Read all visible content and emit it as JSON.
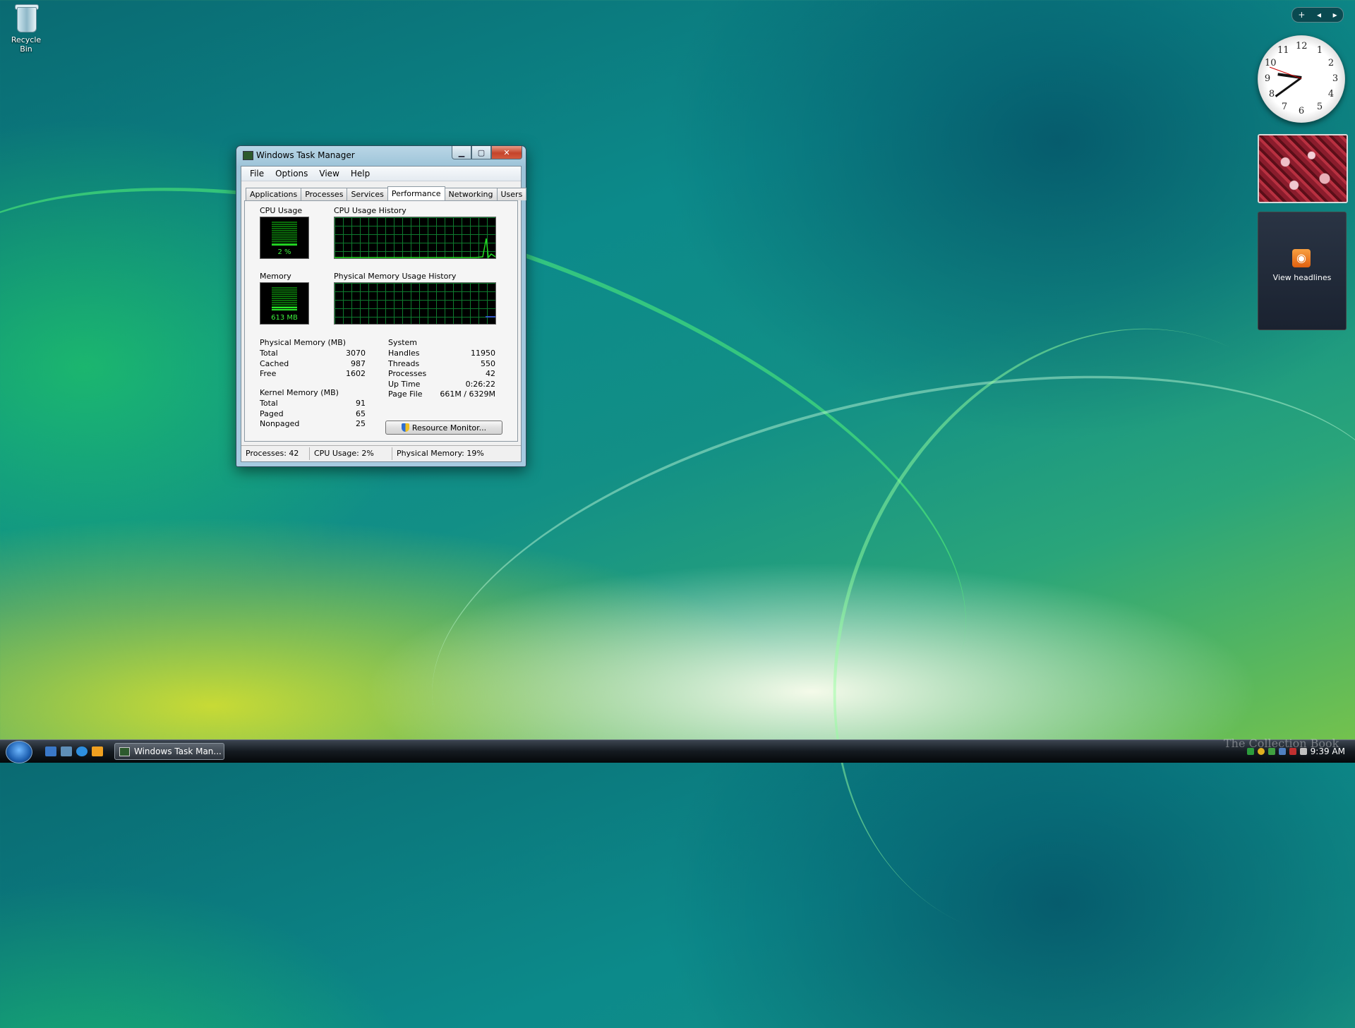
{
  "desktop": {
    "recycle_bin_label": "Recycle Bin"
  },
  "window": {
    "title": "Windows Task Manager",
    "menu": [
      "File",
      "Options",
      "View",
      "Help"
    ],
    "tabs": [
      "Applications",
      "Processes",
      "Services",
      "Performance",
      "Networking",
      "Users"
    ],
    "active_tab": "Performance",
    "cpu_usage": {
      "title": "CPU Usage",
      "value_label": "2 %",
      "percent": 2
    },
    "cpu_history": {
      "title": "CPU Usage History"
    },
    "memory": {
      "title": "Memory",
      "value_label": "613 MB",
      "percent": 19
    },
    "memory_history": {
      "title": "Physical Memory Usage History"
    },
    "physical_memory": {
      "title": "Physical Memory (MB)",
      "rows": [
        {
          "label": "Total",
          "value": "3070"
        },
        {
          "label": "Cached",
          "value": "987"
        },
        {
          "label": "Free",
          "value": "1602"
        }
      ]
    },
    "kernel_memory": {
      "title": "Kernel Memory (MB)",
      "rows": [
        {
          "label": "Total",
          "value": "91"
        },
        {
          "label": "Paged",
          "value": "65"
        },
        {
          "label": "Nonpaged",
          "value": "25"
        }
      ]
    },
    "system": {
      "title": "System",
      "rows": [
        {
          "label": "Handles",
          "value": "11950"
        },
        {
          "label": "Threads",
          "value": "550"
        },
        {
          "label": "Processes",
          "value": "42"
        },
        {
          "label": "Up Time",
          "value": "0:26:22"
        },
        {
          "label": "Page File",
          "value": "661M / 6329M"
        }
      ]
    },
    "resource_monitor_button": "Resource Monitor...",
    "status": {
      "processes": "Processes: 42",
      "cpu": "CPU Usage: 2%",
      "memory": "Physical Memory: 19%"
    }
  },
  "sidebar": {
    "add_button": "+",
    "prev_button": "◂",
    "next_button": "▸",
    "clock_numbers": [
      "12",
      "1",
      "2",
      "3",
      "4",
      "5",
      "6",
      "7",
      "8",
      "9",
      "10",
      "11"
    ],
    "feed_label": "View headlines"
  },
  "taskbar": {
    "task_button_label": "Windows Task Man...",
    "clock": "9:39 AM"
  },
  "watermark": "The Collection Book",
  "colors": {
    "graph_line": "#22dd22",
    "graph_grid": "#0e7a2e",
    "memory_line": "#4060ff"
  }
}
